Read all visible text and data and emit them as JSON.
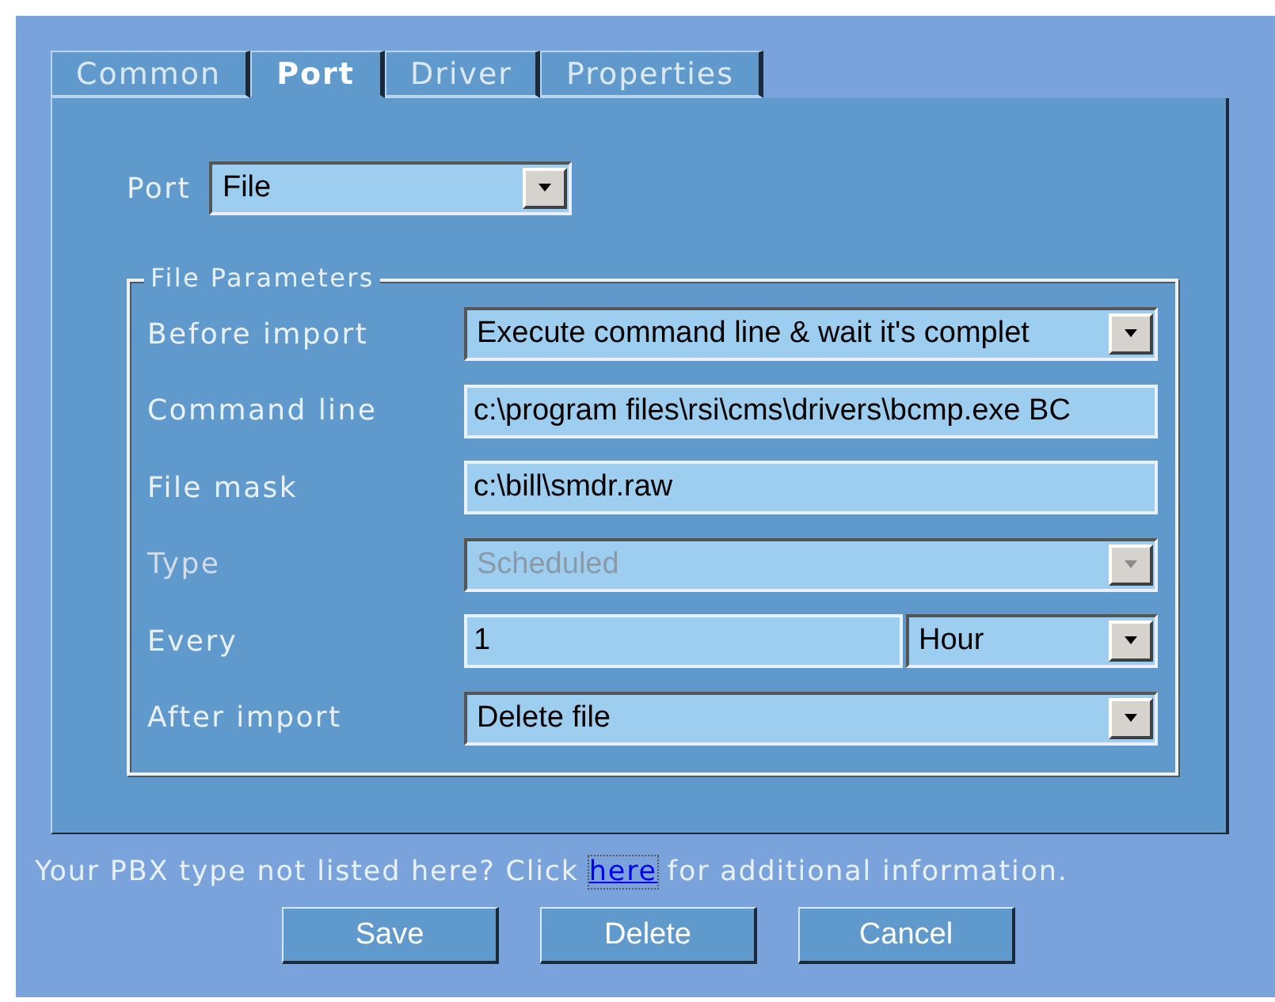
{
  "tabs": [
    {
      "label": "Common",
      "selected": false
    },
    {
      "label": "Port",
      "selected": true
    },
    {
      "label": "Driver",
      "selected": false
    },
    {
      "label": "Properties",
      "selected": false
    }
  ],
  "port": {
    "label": "Port",
    "value": "File"
  },
  "group": {
    "title": "File Parameters",
    "fields": [
      {
        "label": "Before import",
        "kind": "select",
        "value": "Execute command line & wait it's complet",
        "disabled": false
      },
      {
        "label": "Command line",
        "kind": "text",
        "value": "c:\\program files\\rsi\\cms\\drivers\\bcmp.exe BC",
        "disabled": false
      },
      {
        "label": "File mask",
        "kind": "text",
        "value": "c:\\bill\\smdr.raw",
        "disabled": false
      },
      {
        "label": "Type",
        "kind": "select",
        "value": "Scheduled",
        "disabled": true
      },
      {
        "label": "Every",
        "kind": "text_select",
        "value": "1",
        "unit": "Hour",
        "disabled": false
      },
      {
        "label": "After import",
        "kind": "select",
        "value": "Delete file",
        "disabled": false
      }
    ]
  },
  "footer": {
    "before": "Your PBX type not listed here? Click ",
    "link": "here",
    "after": " for additional information."
  },
  "buttons": [
    "Save",
    "Delete",
    "Cancel"
  ]
}
